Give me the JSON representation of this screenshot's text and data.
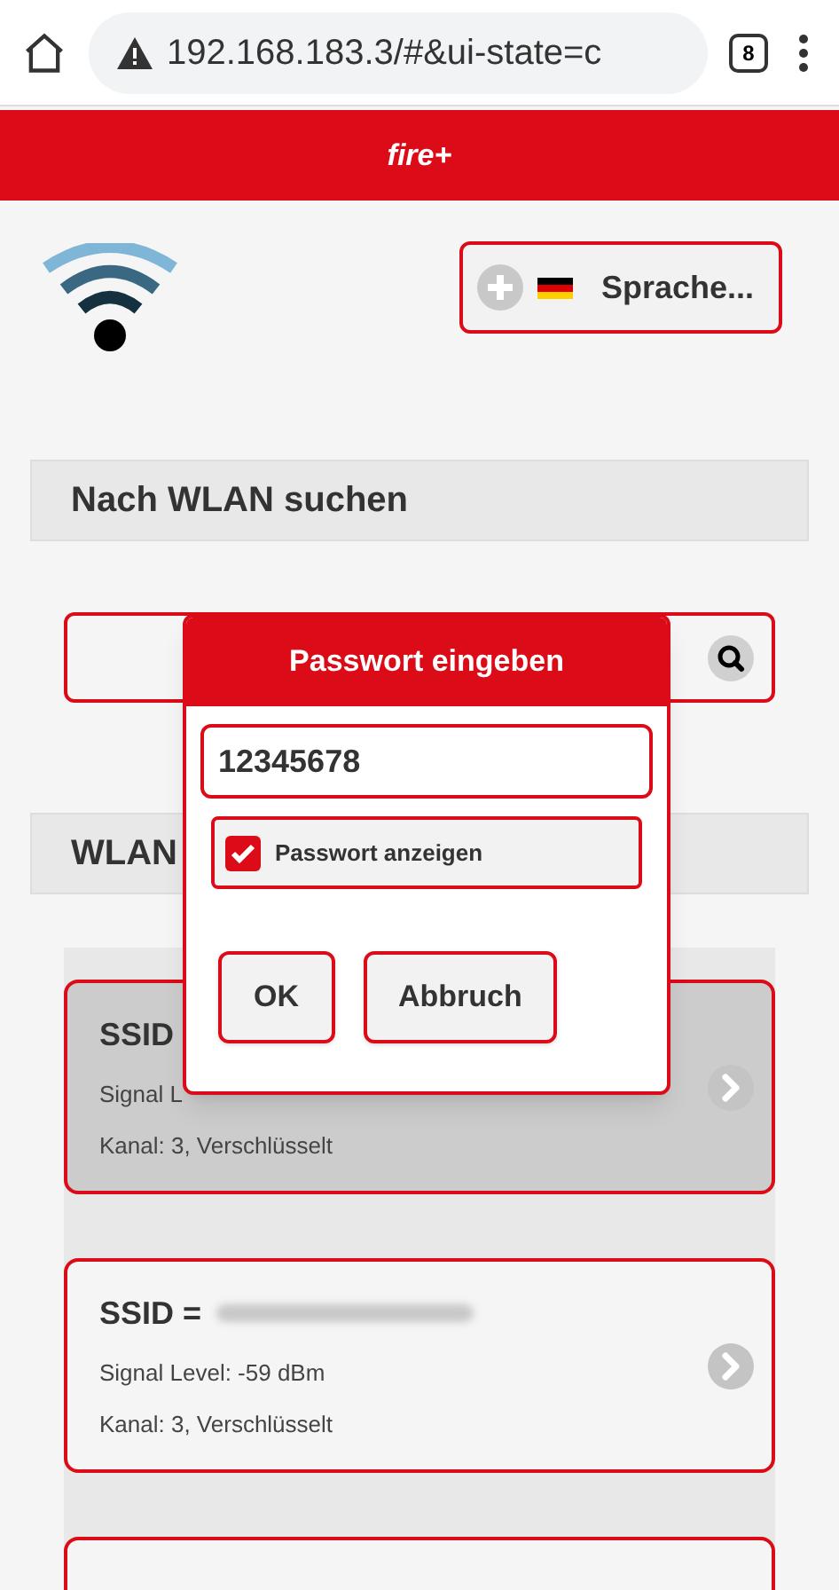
{
  "browser": {
    "url": "192.168.183.3/#&ui-state=c",
    "tab_count": "8"
  },
  "header": {
    "title": "fire+"
  },
  "language_button": {
    "label": "Sprache..."
  },
  "search_section": {
    "title": "Nach WLAN suchen"
  },
  "list_section": {
    "title": "WLAN"
  },
  "networks": [
    {
      "ssid_label": "SSID",
      "signal": "Signal L",
      "channel": "Kanal: 3, Verschlüsselt",
      "selected": true
    },
    {
      "ssid_label": "SSID =",
      "signal": "Signal Level: -59 dBm",
      "channel": "Kanal: 3, Verschlüsselt",
      "selected": false
    },
    {
      "selected": false
    }
  ],
  "dialog": {
    "title": "Passwort eingeben",
    "password": "12345678",
    "show_password": {
      "label": "Passwort anzeigen",
      "checked": true
    },
    "buttons": [
      "OK",
      "Abbruch"
    ]
  }
}
